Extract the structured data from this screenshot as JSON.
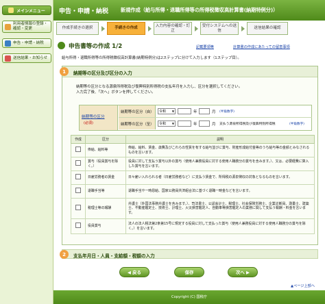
{
  "sidebar": {
    "menu_label": "メインメニュー",
    "items": [
      {
        "label": "利用者情報の登録・確認・変更",
        "icon": "user-icon",
        "color": "#e8a23c"
      },
      {
        "label": "申告・申請・納税",
        "icon": "document-icon",
        "color": "#3a7fc4"
      },
      {
        "label": "送信結果・お知らせ",
        "icon": "mail-icon",
        "color": "#d9534f"
      }
    ]
  },
  "header": {
    "section": "申告・申請・納税",
    "title": "新規作成（給与所得・退職所得等の所得税徴収高計算書(納期特例分)）"
  },
  "steps": [
    {
      "label": "作成手続きの選択",
      "active": false
    },
    {
      "label": "手続きの作成",
      "active": true
    },
    {
      "label": "入力内容の確認・訂正",
      "active": false
    },
    {
      "label": "受付システムへの送信",
      "active": false
    },
    {
      "label": "送信結果の確認",
      "active": false
    }
  ],
  "page": {
    "title": "申告書等の作成 1/2",
    "link_example": "記載要領等",
    "link_notes": "計算書の作成にあたっての留意事項",
    "intro": "給与所得・退職所得等の所得税徴収高計算書(納期特例分)は2ステップに分けて入力します（1ステップ目）。"
  },
  "section1": {
    "number": "1",
    "title": "納期等の区分及び区分の入力",
    "desc_line1": "納期等の区分となる源泉所得税及び復興特別所得税の支払年月を入力し、区分を選択してください。",
    "desc_line2": "入力完了後、「次へ」ボタンを押してください。",
    "form": {
      "label": "納期等の区分",
      "required": "(必須)",
      "from_label": "納期等の区分（自）",
      "to_label": "納期等の区分（至）",
      "era": "令和",
      "year_unit": "年",
      "month_unit": "月",
      "half_width_note": "(半角数字)",
      "to_note": "支払う源泉所得税及び復興特別所得税"
    },
    "table": {
      "headers": [
        "作成",
        "区分",
        "説明"
      ],
      "rows": [
        {
          "category": "俸給、給料等",
          "description": "俸給、給料、賃金、歳費及びこれらの性質を有する給与並びに賞与、財産形成給付金等のうち給与等の金額とみなされるものを言います。"
        },
        {
          "category": "賞与（役員賞与を除く。）",
          "description": "役員に対して支払う賞与以外の賞与（使用人兼務役員に対する使用人職務分の賞与を含みます。）、又は、必要経費に算入した賞与を言います。"
        },
        {
          "category": "日雇労務者の賃金",
          "description": "日々雇い入れられる者（日雇労務者など）に支払う賃金で、所得税の源泉徴収の対象となるものを言います。"
        },
        {
          "category": "退職手当等",
          "description": "退職手当や一時恩給、国家公務員共済組合法に基づく退職一時金などを言います。"
        },
        {
          "category": "税理士等の報酬",
          "description": "弁護士（外国法事務弁護士を含みます。）、司法書士、公認会計士、税理士、社会保険労務士、企業診断員、測量士、建築士、不動産鑑定士、技術士、計理士、火災損害鑑定人、自動車等損害鑑定人の業務に関して支払う報酬・料金を言います。"
        },
        {
          "category": "役員賞与",
          "description": "法人の法人税法第2条第15号に規定する役員に対して支払った賞与（使用人兼務役員に対する使用人職務分の賞与を除く。）を言います。"
        }
      ]
    }
  },
  "section2": {
    "number": "2",
    "title": "支払年月日・人員・支給額・税額の入力"
  },
  "buttons": {
    "back": "戻る",
    "save": "保存",
    "next": "次へ"
  },
  "page_top": "ページ上部へ",
  "footer": "Copyright (C) 国税庁"
}
